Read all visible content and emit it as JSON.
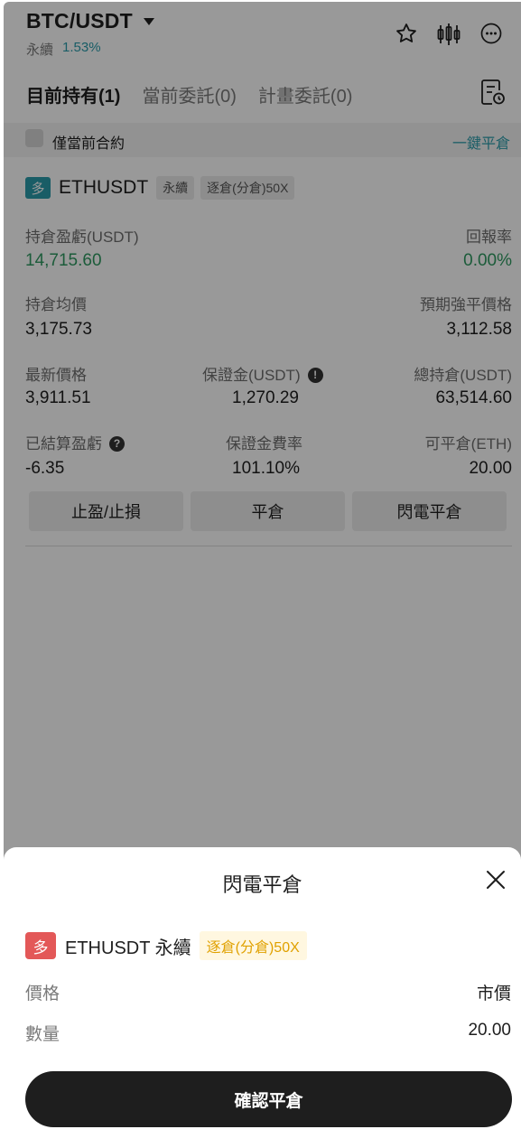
{
  "header": {
    "pair": "BTC/USDT",
    "contract_type": "永續",
    "change": "1.53%"
  },
  "icons": {
    "favorite": "star-icon",
    "chart": "candlestick-icon",
    "more": "more-icon",
    "orders": "order-history-icon"
  },
  "tabs": [
    {
      "label": "目前持有(1)",
      "active": true
    },
    {
      "label": "當前委託(0)",
      "active": false
    },
    {
      "label": "計畫委託(0)",
      "active": false
    }
  ],
  "filter": {
    "label": "僅當前合約",
    "one_click_close": "一鍵平倉"
  },
  "position": {
    "side": "多",
    "symbol": "ETHUSDT",
    "contract_type": "永續",
    "margin_mode": "逐倉(分倉)50X",
    "unrealized_pnl_label": "持倉盈虧(USDT)",
    "unrealized_pnl": "14,715.60",
    "roe_label": "回報率",
    "roe": "0.00%",
    "entry_price_label": "持倉均價",
    "entry_price": "3,175.73",
    "liq_price_label": "預期強平價格",
    "liq_price": "3,112.58",
    "mark_price_label": "最新價格",
    "mark_price": "3,911.51",
    "margin_label": "保證金(USDT)",
    "margin": "1,270.29",
    "total_size_label": "總持倉(USDT)",
    "total_size": "63,514.60",
    "realized_pnl_label": "已結算盈虧",
    "realized_pnl": "-6.35",
    "margin_rate_label": "保證金費率",
    "margin_rate": "101.10%",
    "closable_label": "可平倉(ETH)",
    "closable": "20.00",
    "buttons": {
      "tp_sl": "止盈/止損",
      "close": "平倉",
      "flash_close": "閃電平倉"
    }
  },
  "sheet": {
    "title": "閃電平倉",
    "side": "多",
    "symbol": "ETHUSDT 永續",
    "margin_mode": "逐倉(分倉)50X",
    "price_label": "價格",
    "price_value": "市價",
    "qty_label": "數量",
    "qty_value": "20.00",
    "confirm": "確認平倉"
  },
  "colors": {
    "accent": "#2a9cab",
    "profit": "#2f9a62",
    "long_badge_sheet": "#e35858",
    "margin_tag": "#e0a100",
    "confirm_button": "#1e1e1e"
  }
}
